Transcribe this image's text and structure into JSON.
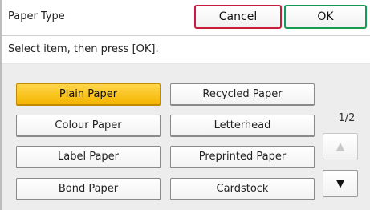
{
  "header": {
    "title": "Paper Type",
    "cancel_label": "Cancel",
    "ok_label": "OK"
  },
  "instruction": "Select item, then press [OK].",
  "options": [
    {
      "label": "Plain Paper",
      "selected": true
    },
    {
      "label": "Recycled Paper",
      "selected": false
    },
    {
      "label": "Colour Paper",
      "selected": false
    },
    {
      "label": "Letterhead",
      "selected": false
    },
    {
      "label": "Label Paper",
      "selected": false
    },
    {
      "label": "Preprinted Paper",
      "selected": false
    },
    {
      "label": "Bond Paper",
      "selected": false
    },
    {
      "label": "Cardstock",
      "selected": false
    }
  ],
  "pager": {
    "text": "1/2",
    "up_icon": "arrow-up-icon",
    "down_icon": "arrow-down-icon",
    "up_glyph": "▲",
    "down_glyph": "▼"
  },
  "colors": {
    "selected": "#f4b400",
    "cancel_border": "#c81d3a",
    "ok_border": "#169b52"
  }
}
